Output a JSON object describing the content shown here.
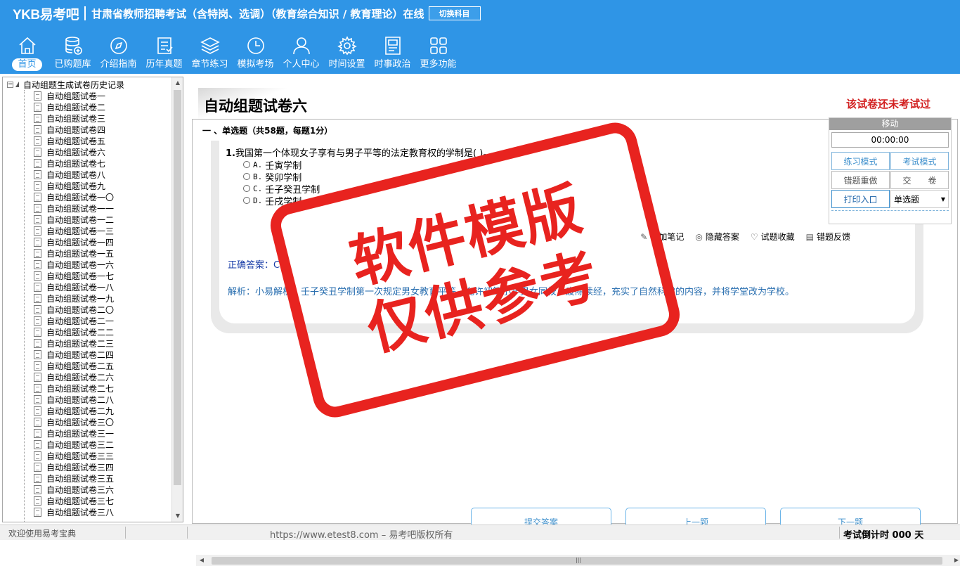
{
  "header": {
    "logo": "YKB易考吧",
    "app_title": "甘肃省教师招聘考试（含特岗、选调）（教育综合知识 / 教育理论）在线",
    "switch_label": "切换科目"
  },
  "nav": [
    {
      "label": "首页",
      "icon": "home-icon"
    },
    {
      "label": "已购题库",
      "icon": "database-icon"
    },
    {
      "label": "介绍指南",
      "icon": "compass-icon"
    },
    {
      "label": "历年真题",
      "icon": "list-icon"
    },
    {
      "label": "章节练习",
      "icon": "layers-icon"
    },
    {
      "label": "模拟考场",
      "icon": "clock-icon"
    },
    {
      "label": "个人中心",
      "icon": "user-icon"
    },
    {
      "label": "时间设置",
      "icon": "gear-icon"
    },
    {
      "label": "时事政治",
      "icon": "news-icon"
    },
    {
      "label": "更多功能",
      "icon": "grid-icon"
    }
  ],
  "tree": {
    "root": "自动组题生成试卷历史记录",
    "items": [
      "自动组题试卷一",
      "自动组题试卷二",
      "自动组题试卷三",
      "自动组题试卷四",
      "自动组题试卷五",
      "自动组题试卷六",
      "自动组题试卷七",
      "自动组题试卷八",
      "自动组题试卷九",
      "自动组题试卷一〇",
      "自动组题试卷一一",
      "自动组题试卷一二",
      "自动组题试卷一三",
      "自动组题试卷一四",
      "自动组题试卷一五",
      "自动组题试卷一六",
      "自动组题试卷一七",
      "自动组题试卷一八",
      "自动组题试卷一九",
      "自动组题试卷二〇",
      "自动组题试卷二一",
      "自动组题试卷二二",
      "自动组题试卷二三",
      "自动组题试卷二四",
      "自动组题试卷二五",
      "自动组题试卷二六",
      "自动组题试卷二七",
      "自动组题试卷二八",
      "自动组题试卷二九",
      "自动组题试卷三〇",
      "自动组题试卷三一",
      "自动组题试卷三二",
      "自动组题试卷三三",
      "自动组题试卷三四",
      "自动组题试卷三五",
      "自动组题试卷三六",
      "自动组题试卷三七",
      "自动组题试卷三八"
    ]
  },
  "paper": {
    "title": "自动组题试卷六",
    "status": "该试卷还未考试过",
    "section": "一 、单选题（共58题，每题1分）",
    "question_num": "1.",
    "question": "我国第一个体现女子享有与男子平等的法定教育权的学制是( )。",
    "options": [
      {
        "letter": "A.",
        "text": "壬寅学制"
      },
      {
        "letter": "B.",
        "text": "癸卯学制"
      },
      {
        "letter": "C.",
        "text": "壬子癸丑学制"
      },
      {
        "letter": "D.",
        "text": "壬戌学制"
      }
    ],
    "tools": [
      {
        "label": "添加笔记",
        "icon": "pencil-icon"
      },
      {
        "label": "隐藏答案",
        "icon": "eye-off-icon"
      },
      {
        "label": "试题收藏",
        "icon": "heart-icon"
      },
      {
        "label": "错题反馈",
        "icon": "feedback-icon"
      }
    ],
    "answer": "正确答案：C",
    "analysis": "解析：小易解析：壬子癸丑学制第一次规定男女教育平等，允许初等小学男女同校，废除读经，充实了自然科学的内容，并将学堂改为学校。",
    "buttons": {
      "submit": "提交答案",
      "prev": "上一题",
      "next": "下一题"
    }
  },
  "float_panel": {
    "move": "移动",
    "timer": "00:00:00",
    "practice": "练习模式",
    "exam": "考试模式",
    "redo": "错题重做",
    "hand_in": "交　　卷",
    "print": "打印入口",
    "type_select": "单选题"
  },
  "statusbar": {
    "welcome": "欢迎使用易考宝典",
    "url": "https://www.etest8.com – 易考吧版权所有",
    "countdown": "考试倒计时 000 天"
  },
  "watermark": {
    "line1": "软件模版",
    "line2": "仅供参考"
  },
  "colors": {
    "header": "#2f95e6",
    "stamp": "#e8231f",
    "status_red": "#d21f1f",
    "answer_blue": "#1a3ea8"
  }
}
